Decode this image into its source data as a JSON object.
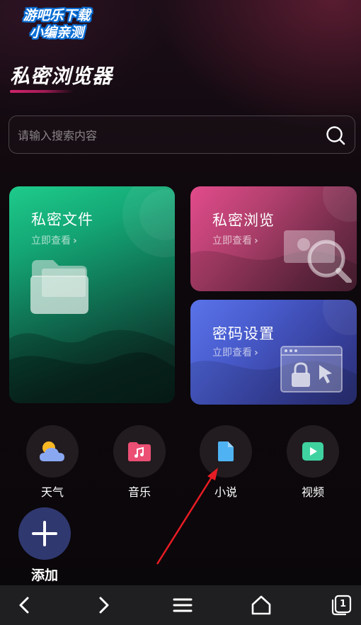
{
  "watermark": {
    "line1": "游吧乐下载",
    "line2": "小编亲测"
  },
  "page": {
    "title": "私密浏览器"
  },
  "search": {
    "placeholder": "请输入搜索内容",
    "icon": "search-icon"
  },
  "cards": {
    "files": {
      "title": "私密文件",
      "subtitle": "立即查看",
      "icon": "folder-icon",
      "color": "#1ecb8b"
    },
    "browse": {
      "title": "私密浏览",
      "subtitle": "立即查看",
      "icon": "magnifier-photo-icon",
      "color": "#e24b8b"
    },
    "password": {
      "title": "密码设置",
      "subtitle": "立即查看",
      "icon": "lock-window-icon",
      "color": "#5a73e8"
    }
  },
  "apps": [
    {
      "label": "天气",
      "icon": "weather-icon"
    },
    {
      "label": "音乐",
      "icon": "music-folder-icon"
    },
    {
      "label": "小说",
      "icon": "document-icon"
    },
    {
      "label": "视频",
      "icon": "video-play-icon"
    }
  ],
  "add": {
    "label": "添加",
    "icon": "plus-icon"
  },
  "annotation": {
    "color": "#e81c24",
    "target": "小说"
  },
  "bottom_nav": {
    "back_icon": "back-arrow-icon",
    "forward_icon": "forward-arrow-icon",
    "menu_icon": "menu-icon",
    "home_icon": "home-icon",
    "tabs_icon": "tabs-icon",
    "tabs_count": "1"
  }
}
